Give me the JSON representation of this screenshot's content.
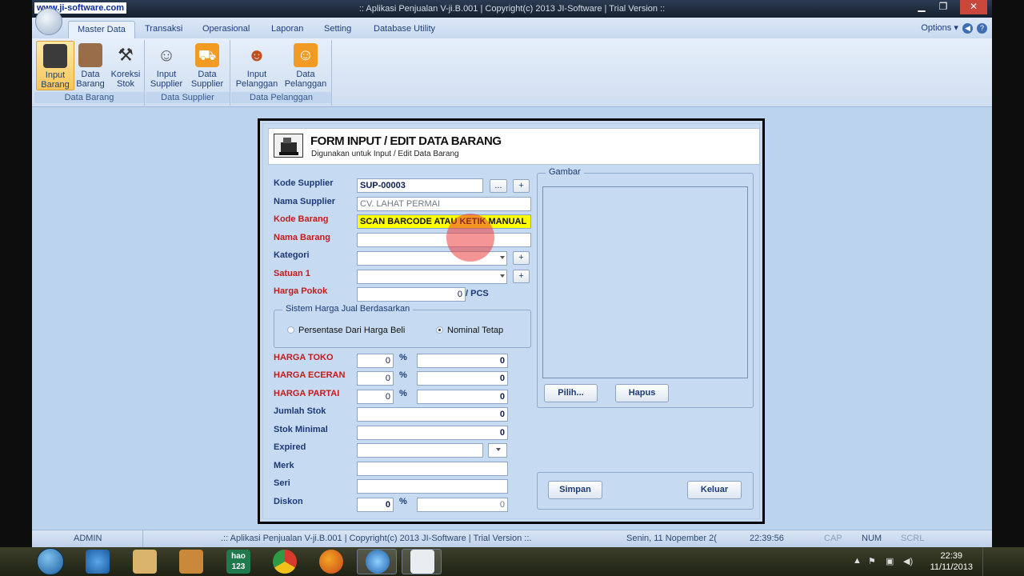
{
  "window": {
    "watermark": "www.ji-software.com",
    "title": "::  Aplikasi Penjualan V-ji.B.001   |  Copyright(c) 2013 JI-Software   |   Trial Version  ::",
    "minimize": "▁",
    "restore": "❐",
    "close": "✕"
  },
  "ribbon": {
    "tabs": [
      "Master Data",
      "Transaksi",
      "Operasional",
      "Laporan",
      "Setting",
      "Database Utility"
    ],
    "options_label": "Options",
    "groups": [
      {
        "label": "Data Barang",
        "buttons": [
          [
            "Input",
            "Barang"
          ],
          [
            "Data",
            "Barang"
          ],
          [
            "Koreksi",
            "Stok"
          ]
        ]
      },
      {
        "label": "Data Supplier",
        "buttons": [
          [
            "Input",
            "Supplier"
          ],
          [
            "Data",
            "Supplier"
          ]
        ]
      },
      {
        "label": "Data Pelanggan",
        "buttons": [
          [
            "Input",
            "Pelanggan"
          ],
          [
            "Data",
            "Pelanggan"
          ]
        ]
      }
    ]
  },
  "form": {
    "title": "FORM INPUT / EDIT DATA BARANG",
    "subtitle": "Digunakan untuk Input / Edit Data Barang",
    "labels": {
      "kode_supplier": "Kode Supplier",
      "nama_supplier": "Nama Supplier",
      "kode_barang": "Kode Barang",
      "nama_barang": "Nama Barang",
      "kategori": "Kategori",
      "satuan1": "Satuan 1",
      "harga_pokok": "Harga Pokok",
      "harga_toko": "HARGA TOKO",
      "harga_eceran": "HARGA ECERAN",
      "harga_partai": "HARGA PARTAI",
      "jumlah_stok": "Jumlah Stok",
      "stok_minimal": "Stok Minimal",
      "expired": "Expired",
      "merk": "Merk",
      "seri": "Seri",
      "diskon": "Diskon"
    },
    "values": {
      "kode_supplier": "SUP-00003",
      "nama_supplier": "CV. LAHAT PERMAI",
      "kode_barang": "SCAN BARCODE ATAU KETIK MANUAL",
      "harga_pokok": "0",
      "harga_pokok_unit": "/ PCS",
      "harga_toko_pct": "0",
      "harga_toko": "0",
      "harga_eceran_pct": "0",
      "harga_eceran": "0",
      "harga_partai_pct": "0",
      "harga_partai": "0",
      "jumlah_stok": "0",
      "stok_minimal": "0",
      "diskon_pct": "0",
      "diskon": "0"
    },
    "pct_symbol": "%",
    "browse_button": "...",
    "add_button": "+",
    "sistem_harga": {
      "legend": "Sistem Harga Jual Berdasarkan",
      "option1": "Persentase Dari Harga Beli",
      "option2": "Nominal Tetap",
      "selected": "Nominal Tetap"
    },
    "gambar": {
      "legend": "Gambar",
      "pilih": "Pilih...",
      "hapus": "Hapus"
    },
    "simpan": "Simpan",
    "keluar": "Keluar"
  },
  "statusbar": {
    "user": "ADMIN",
    "app_info": ".::  Aplikasi Penjualan V-ji.B.001   |   Copyright(c) 2013 JI-Software   |   Trial Version  ::.",
    "date": "Senin, 11 Nopember 2(",
    "time": "22:39:56",
    "cap": "CAP",
    "num": "NUM",
    "scrl": "SCRL"
  },
  "taskbar": {
    "clock_time": "22:39",
    "clock_date": "11/11/2013",
    "hao_label": "hao\n123"
  },
  "colors": {
    "ribbon_active": "#f8c55c",
    "label_red": "#c41b1b",
    "label_blue": "#1c3a75",
    "barcode_bg": "#ffff00"
  }
}
